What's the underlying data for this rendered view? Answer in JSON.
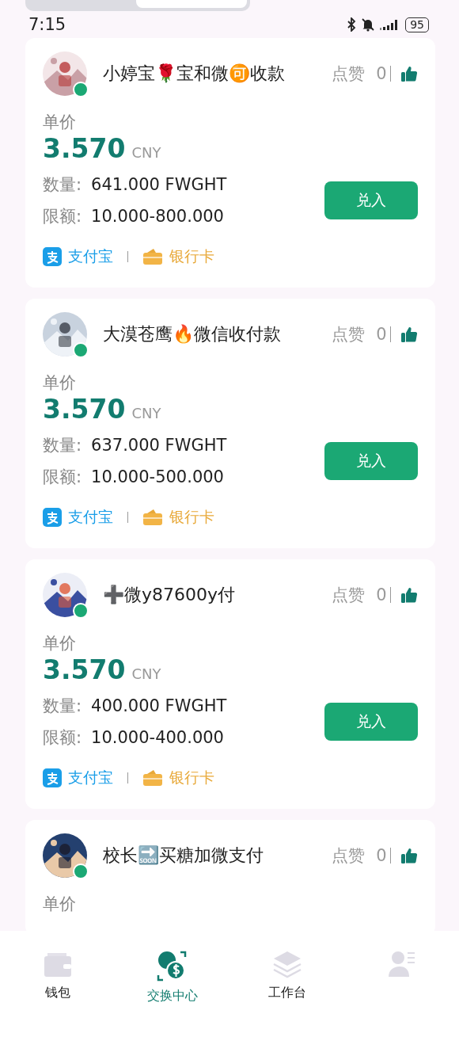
{
  "status_bar": {
    "time": "7:15",
    "battery": "95"
  },
  "offers": [
    {
      "name": "小婷宝🌹宝和微🉑收款",
      "likes_label": "点赞",
      "likes": "0",
      "online": true,
      "unit_label": "单价",
      "price": "3.570",
      "currency": "CNY",
      "qty_label": "数量:",
      "qty": "641.000 FWGHT",
      "limit_label": "限额:",
      "limit": "10.000-800.000",
      "button": "兑入",
      "payments": [
        {
          "kind": "alipay",
          "label": "支付宝"
        },
        {
          "kind": "bank",
          "label": "银行卡"
        }
      ]
    },
    {
      "name": "大漠苍鹰🔥微信收付款",
      "likes_label": "点赞",
      "likes": "0",
      "online": true,
      "unit_label": "单价",
      "price": "3.570",
      "currency": "CNY",
      "qty_label": "数量:",
      "qty": "637.000 FWGHT",
      "limit_label": "限额:",
      "limit": "10.000-500.000",
      "button": "兑入",
      "payments": [
        {
          "kind": "alipay",
          "label": "支付宝"
        },
        {
          "kind": "bank",
          "label": "银行卡"
        }
      ]
    },
    {
      "name": "➕微y87600y付",
      "likes_label": "点赞",
      "likes": "0",
      "online": true,
      "unit_label": "单价",
      "price": "3.570",
      "currency": "CNY",
      "qty_label": "数量:",
      "qty": "400.000 FWGHT",
      "limit_label": "限额:",
      "limit": "10.000-400.000",
      "button": "兑入",
      "payments": [
        {
          "kind": "alipay",
          "label": "支付宝"
        },
        {
          "kind": "bank",
          "label": "银行卡"
        }
      ]
    },
    {
      "name": "校长🔜买糖加微支付",
      "likes_label": "点赞",
      "likes": "0",
      "online": true,
      "unit_label": "单价"
    }
  ],
  "nav": [
    {
      "kind": "wallet",
      "label": "钱包",
      "selected": false
    },
    {
      "kind": "exchange",
      "label": "交换中心",
      "selected": true
    },
    {
      "kind": "layers",
      "label": "工作台",
      "selected": false
    },
    {
      "kind": "profile",
      "selected": false
    }
  ]
}
